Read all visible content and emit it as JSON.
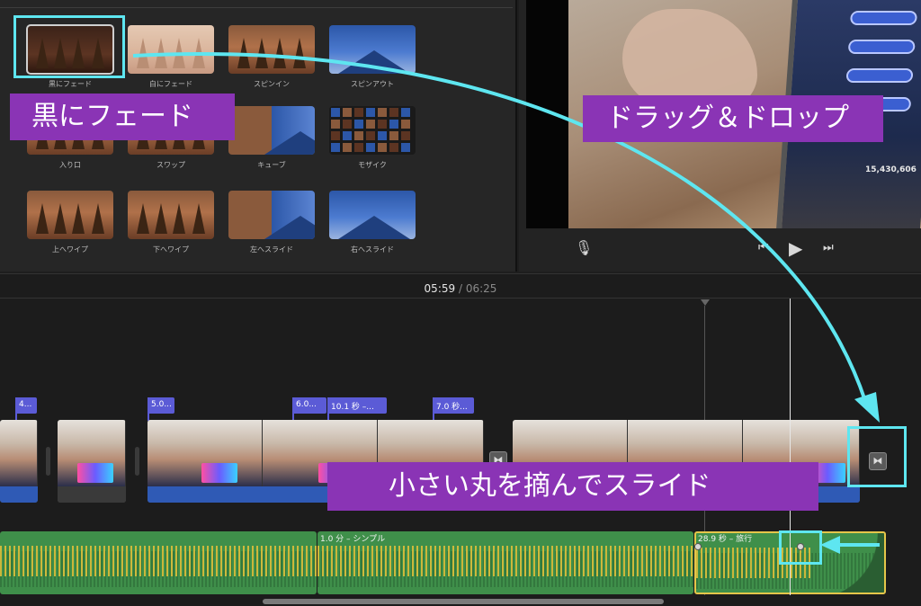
{
  "transitions": {
    "tiles": [
      {
        "label": "黒にフェード",
        "style": "th-dark",
        "selected": true
      },
      {
        "label": "白にフェード",
        "style": "th-white"
      },
      {
        "label": "スピンイン",
        "style": "th-forest"
      },
      {
        "label": "スピンアウト",
        "style": "th-blue"
      },
      {
        "label": "入り口",
        "style": "th-forest"
      },
      {
        "label": "スワップ",
        "style": "th-forest"
      },
      {
        "label": "キューブ",
        "style": "th-split"
      },
      {
        "label": "モザイク",
        "style": "th-mosaic"
      },
      {
        "label": "上へワイプ",
        "style": "th-forest"
      },
      {
        "label": "下へワイプ",
        "style": "th-forest"
      },
      {
        "label": "左へスライド",
        "style": "th-split"
      },
      {
        "label": "右へスライド",
        "style": "th-blue"
      }
    ]
  },
  "viewer": {
    "score_text": "15,430,606",
    "mic_icon": "microphone-icon",
    "controls": [
      "skip-back-icon",
      "play-icon",
      "skip-forward-icon"
    ],
    "control_glyphs": {
      "mic": "🎙",
      "back": "⏮",
      "play": "▶",
      "forward": "⏭"
    }
  },
  "timeline": {
    "current_time": "05:59",
    "separator": "/",
    "total_time": "06:25",
    "title_tags": [
      "4...",
      "5.0...",
      "6.0...",
      "10.1 秒 –...",
      "7.0 秒..."
    ],
    "transition_glyph": "⧓",
    "audio_clips": [
      {
        "label": ""
      },
      {
        "label": "1.0 分 – シンプル"
      },
      {
        "label": "28.9 秒 – 旅行"
      }
    ]
  },
  "annotations": {
    "fade_to_black": "黒にフェード",
    "drag_drop": "ドラッグ＆ドロップ",
    "slide_knob": "小さい丸を摘んでスライド"
  },
  "colors": {
    "annotation_banner": "#8a34b5",
    "highlight": "#5ee6f0",
    "audio_green": "#3f8f4a",
    "audio_selected_border": "#e5c64a",
    "title_tag": "#5b5bd6"
  }
}
